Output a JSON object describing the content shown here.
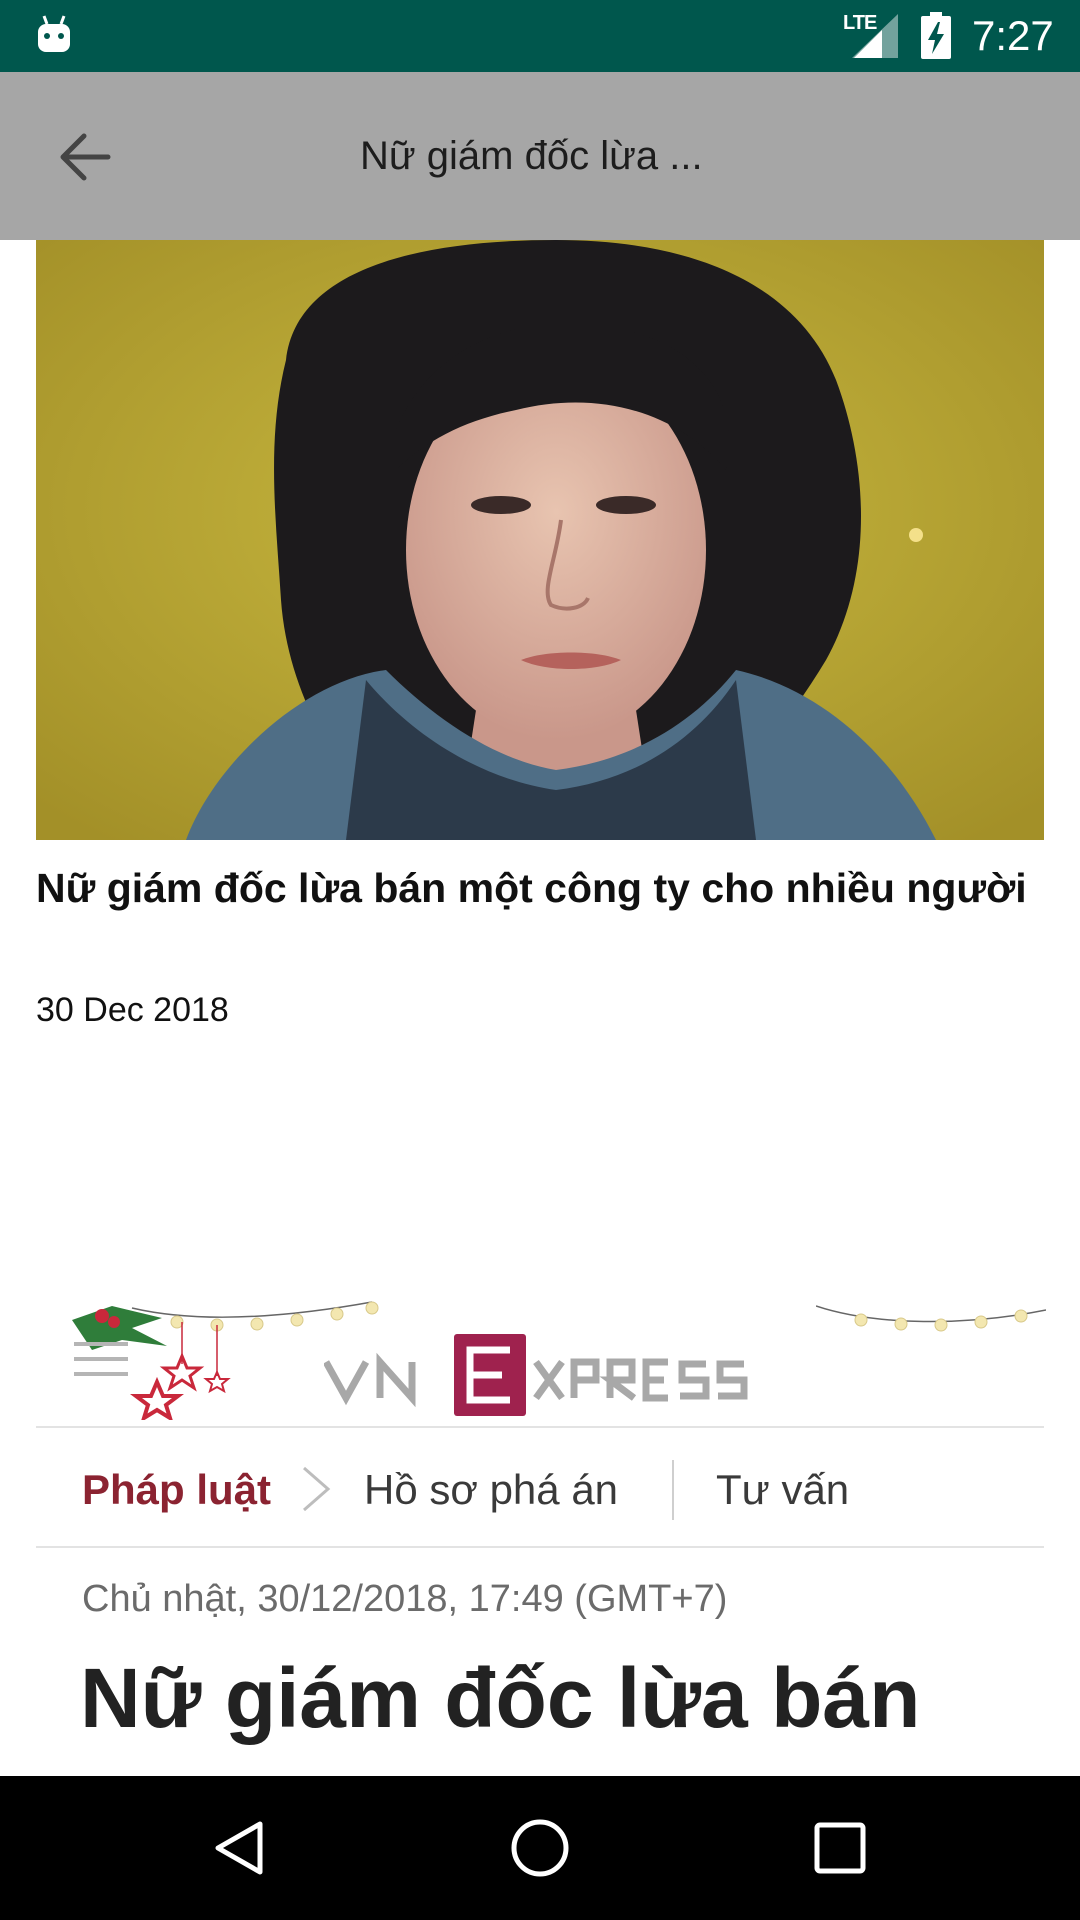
{
  "status_bar": {
    "network": "LTE",
    "time": "7:27"
  },
  "app_bar": {
    "title": "Nữ giám đốc lừa ..."
  },
  "article": {
    "title": "Nữ giám đốc lừa bán một công ty cho nhiều người",
    "date": "30 Dec 2018"
  },
  "web_view": {
    "brand": "VNEXPRESS",
    "breadcrumb": {
      "category": "Pháp luật",
      "subcategory": "Hồ sơ phá án",
      "secondary": "Tư vấn"
    },
    "timestamp": "Chủ nhật, 30/12/2018, 17:49 (GMT+7)",
    "headline": "Nữ giám đốc lừa bán"
  },
  "colors": {
    "status_bar": "#00574d",
    "app_bar": "#a6a6a6",
    "brand_accent": "#9f224e",
    "category_text": "#8b2331"
  },
  "icons": {
    "status_left": "android-notification-icon",
    "signal": "signal-icon",
    "battery": "battery-charging-icon",
    "back": "arrow-back-icon",
    "menu": "hamburger-menu-icon",
    "chevron": "chevron-right-icon",
    "nav_back": "triangle-back-icon",
    "nav_home": "circle-home-icon",
    "nav_recents": "square-recents-icon"
  }
}
